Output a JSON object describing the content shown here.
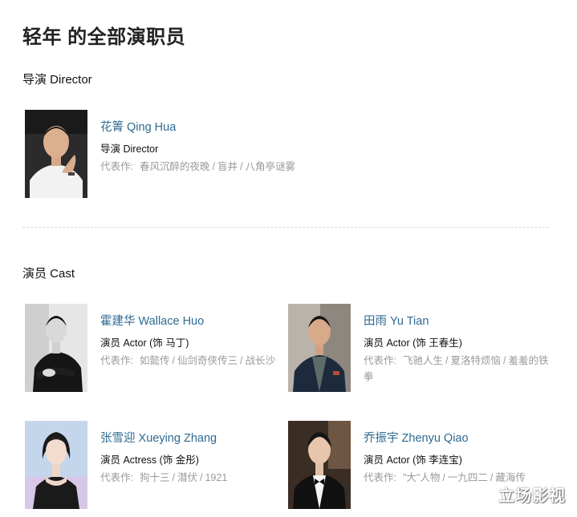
{
  "page": {
    "title": "轻年 的全部演职员"
  },
  "directors": {
    "heading": "导演 Director",
    "people": [
      {
        "name": "花箐 Qing Hua",
        "role": "导演 Director",
        "works_label": "代表作:",
        "works": [
          "春风沉醉的夜晚",
          "盲井",
          "八角亭谜雾"
        ]
      }
    ]
  },
  "cast": {
    "heading": "演员 Cast",
    "people": [
      {
        "name": "霍建华 Wallace Huo",
        "role": "演员 Actor (饰 马丁)",
        "works_label": "代表作:",
        "works": [
          "如懿传",
          "仙剑奇侠传三",
          "战长沙"
        ]
      },
      {
        "name": "田雨 Yu Tian",
        "role": "演员 Actor (饰 王春生)",
        "works_label": "代表作:",
        "works": [
          "飞驰人生",
          "夏洛特烦恼",
          "羞羞的铁拳"
        ]
      },
      {
        "name": "张雪迎 Xueying Zhang",
        "role": "演员 Actress (饰 金彤)",
        "works_label": "代表作:",
        "works": [
          "狗十三",
          "潜伏",
          "1921"
        ]
      },
      {
        "name": "乔振宇 Zhenyu Qiao",
        "role": "演员 Actor (饰 李连宝)",
        "works_label": "代表作:",
        "works": [
          "\"大\"人物",
          "一九四二",
          "藏海传"
        ]
      }
    ]
  },
  "watermark": "立场影视",
  "colors": {
    "name_link": "#2e6a92",
    "muted": "#9a9a9a"
  }
}
